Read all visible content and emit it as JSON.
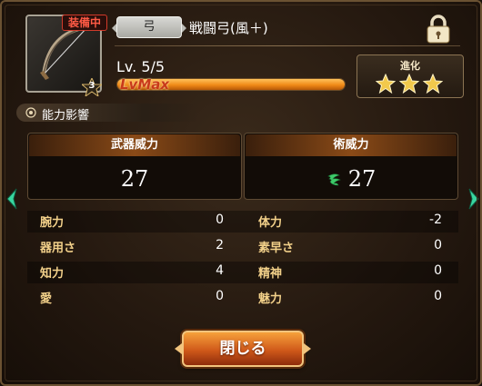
{
  "weapon": {
    "equipped_label": "装備中",
    "category": "弓",
    "name": "戦闘弓(風＋)",
    "rank": "3",
    "icon": "bow-icon"
  },
  "level": {
    "label": "Lv. 5/5",
    "max_label": "LvMax",
    "progress": 1.0
  },
  "evolution": {
    "label": "進化",
    "stars_filled": 3,
    "stars_total": 3
  },
  "lock_icon": "padlock-icon",
  "section": {
    "title": "能力影響"
  },
  "power": {
    "weapon_label": "武器威力",
    "weapon_value": "27",
    "spell_label": "術威力",
    "spell_value": "27",
    "spell_icon": "wind-icon"
  },
  "stats": [
    {
      "name": "腕力",
      "value": "0",
      "name2": "体力",
      "value2": "-2"
    },
    {
      "name": "器用さ",
      "value": "2",
      "name2": "素早さ",
      "value2": "0"
    },
    {
      "name": "知力",
      "value": "4",
      "name2": "精神",
      "value2": "0"
    },
    {
      "name": "愛",
      "value": "0",
      "name2": "魅力",
      "value2": "0"
    }
  ],
  "close_label": "閉じる",
  "colors": {
    "accent": "#f08a17",
    "stat_label": "#f3d18a",
    "arrow": "#39d6a0",
    "equipped": "#ff5a45"
  }
}
